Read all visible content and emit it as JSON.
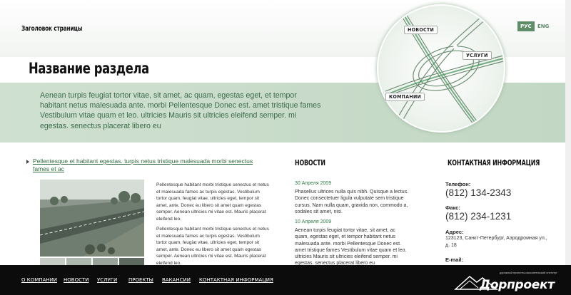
{
  "header": {
    "page_title": "Заголовок страницы"
  },
  "lang": {
    "ru": "РУС",
    "en": "ENG"
  },
  "hero": {
    "section_title": "Название раздела",
    "lead": "Aenean turpis feugiat tortor vitae, sit amet, ac quam, egestas eget, et tempor habitant netus malesuada ante. morbi Pellentesque Donec est. amet tristique fames Vestibulum vitae quam et leo. ultricies Mauris sit ultricies eleifend semper. mi egestas. senectus placerat libero eu",
    "tags": {
      "news": "НОВОСТИ",
      "services": "УСЛУГИ",
      "company": "КОМПАНИИ"
    }
  },
  "article": {
    "link": "Pellentesque et habitant egestas. turpis netus tristique malesuada morbi senectus fames et ac",
    "p1": "Pellentesque habitant morbi tristique senectus et netus et malesuada fames ac turpis egestas. Vestibulum tortor quam, feugiat vitae, ultricies eget, tempor sit amet, ante. Donec eu libero sit amet quam egestas semper. Aenean ultricies mi vitae est. Mauris placerat eleifend leo.",
    "p2": "Pellentesque habitant morbi tristique senectus et netus et malesuada fames ac turpis egestas. Vestibulum tortor quam, feugiat vitae, ultricies eget, tempor sit amet, ante. Donec eu libero sit amet quam egestas semper. Aenean ultricies mi vitae est. Mauris placerat eleifend leo."
  },
  "news": {
    "heading": "НОВОСТИ",
    "items": [
      {
        "date": "30 Апреля 2009",
        "text": "Phasellus ultrices nulla quis nibh. Quisque a lectus. Donec consectetuer ligula vulputate sem tristique cursus. Nam nulla quam, gravida non, commodo a, sodales sit amet, nisi."
      },
      {
        "date": "10 Апреля 2009",
        "text": "Aenean turpis feugiat tortor vitae, sit amet, ac quam, egestas eget, et tempor habitant netus malesuada ante. morbi Pellentesque Donec est. amet tristique fames Vestibulum vitae quam et leo. ultricies Mauris sit ultricies eleifend semper. mi egestas. senectus placerat libero eu"
      }
    ]
  },
  "contacts": {
    "heading": "КОНТАКТНАЯ ИНФОРМАЦИЯ",
    "phone_label": "Телефон:",
    "phone": "(812) 134-2343",
    "fax_label": "Факс:",
    "fax": "(812) 234-1231",
    "address_label": "Адрес:",
    "address": "123123, Санкт-Петербург, Аэродромная ул., д. 18",
    "email_label": "E-mail:"
  },
  "footer": {
    "nav": [
      "О КОМПАНИИ",
      "НОВОСТИ",
      "УСЛУГИ",
      "ПРОЕКТЫ",
      "ВАКАНСИИ",
      "КОНТАКТНАЯ ИНФОРМАЦИЯ"
    ],
    "logo_tagline": "дорожный проектно-изыскательский институт",
    "logo_name": "Дорпроект"
  },
  "colors": {
    "accent": "#5f8d6a",
    "band": "#c9dccb",
    "link": "#2f6a3e",
    "footer": "#0c0c0c"
  }
}
